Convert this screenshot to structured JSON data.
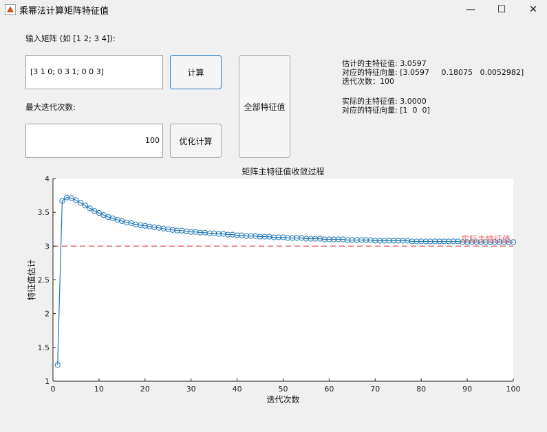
{
  "window": {
    "title": "乘幂法计算矩阵特征值",
    "min_glyph": "—",
    "max_glyph": "☐",
    "close_glyph": "✕"
  },
  "form": {
    "matrix_label": "输入矩阵 (如 [1 2; 3 4]):",
    "matrix_value": "[3 1 0;    0 3 1;     0 0 3]",
    "iter_label": "最大迭代次数:",
    "iter_value": "100",
    "compute_button": "计算",
    "optimize_button": "优化计算",
    "all_eig_button": "全部特征值"
  },
  "results": {
    "line1": "估计的主特征值: 3.0597",
    "line2": "对应的特征向量: [3.0597     0.18075   0.0052982]",
    "line3": "迭代次数：100",
    "line4": "实际的主特征值: 3.0000",
    "line5": "对应的特征向量: [1  0  0]"
  },
  "colors": {
    "series": "#1f77b4",
    "reference": "#e05a5a"
  },
  "chart_data": {
    "type": "line",
    "title": "矩阵主特征值收敛过程",
    "xlabel": "迭代次数",
    "ylabel": "特征值估计",
    "xlim": [
      0,
      100
    ],
    "ylim": [
      1,
      4
    ],
    "xticks": [
      0,
      10,
      20,
      30,
      40,
      50,
      60,
      70,
      80,
      90,
      100
    ],
    "yticks": [
      1,
      1.5,
      2,
      2.5,
      3,
      3.5,
      4
    ],
    "ytick_labels": [
      "1",
      "1.5",
      "2",
      "2.5",
      "3",
      "3.5",
      "4"
    ],
    "reference_line": {
      "y": 3,
      "label": "实际主特征值"
    },
    "series": [
      {
        "marker": "circle",
        "x": [
          1,
          2,
          3,
          4,
          5,
          6,
          7,
          8,
          9,
          10,
          11,
          12,
          13,
          14,
          15,
          16,
          17,
          18,
          19,
          20,
          21,
          22,
          23,
          24,
          25,
          26,
          27,
          28,
          29,
          30,
          31,
          32,
          33,
          34,
          35,
          36,
          37,
          38,
          39,
          40,
          41,
          42,
          43,
          44,
          45,
          46,
          47,
          48,
          49,
          50,
          51,
          52,
          53,
          54,
          55,
          56,
          57,
          58,
          59,
          60,
          61,
          62,
          63,
          64,
          65,
          66,
          67,
          68,
          69,
          70,
          71,
          72,
          73,
          74,
          75,
          76,
          77,
          78,
          79,
          80,
          81,
          82,
          83,
          84,
          85,
          86,
          87,
          88,
          89,
          90,
          91,
          92,
          93,
          94,
          95,
          96,
          97,
          98,
          99,
          100
        ],
        "values": [
          1.24,
          3.67,
          3.72,
          3.71,
          3.68,
          3.64,
          3.6,
          3.56,
          3.52,
          3.49,
          3.46,
          3.43,
          3.41,
          3.39,
          3.37,
          3.35,
          3.34,
          3.32,
          3.31,
          3.3,
          3.29,
          3.28,
          3.27,
          3.26,
          3.25,
          3.24,
          3.23,
          3.23,
          3.22,
          3.21,
          3.21,
          3.2,
          3.2,
          3.19,
          3.19,
          3.18,
          3.18,
          3.17,
          3.17,
          3.16,
          3.16,
          3.15,
          3.15,
          3.15,
          3.14,
          3.14,
          3.14,
          3.13,
          3.13,
          3.13,
          3.12,
          3.12,
          3.12,
          3.12,
          3.11,
          3.11,
          3.11,
          3.11,
          3.1,
          3.1,
          3.1,
          3.1,
          3.1,
          3.09,
          3.09,
          3.09,
          3.09,
          3.09,
          3.09,
          3.08,
          3.08,
          3.08,
          3.08,
          3.08,
          3.08,
          3.08,
          3.08,
          3.07,
          3.07,
          3.07,
          3.07,
          3.07,
          3.07,
          3.07,
          3.07,
          3.07,
          3.07,
          3.07,
          3.06,
          3.06,
          3.06,
          3.06,
          3.06,
          3.06,
          3.06,
          3.06,
          3.06,
          3.06,
          3.06,
          3.06
        ]
      }
    ]
  }
}
